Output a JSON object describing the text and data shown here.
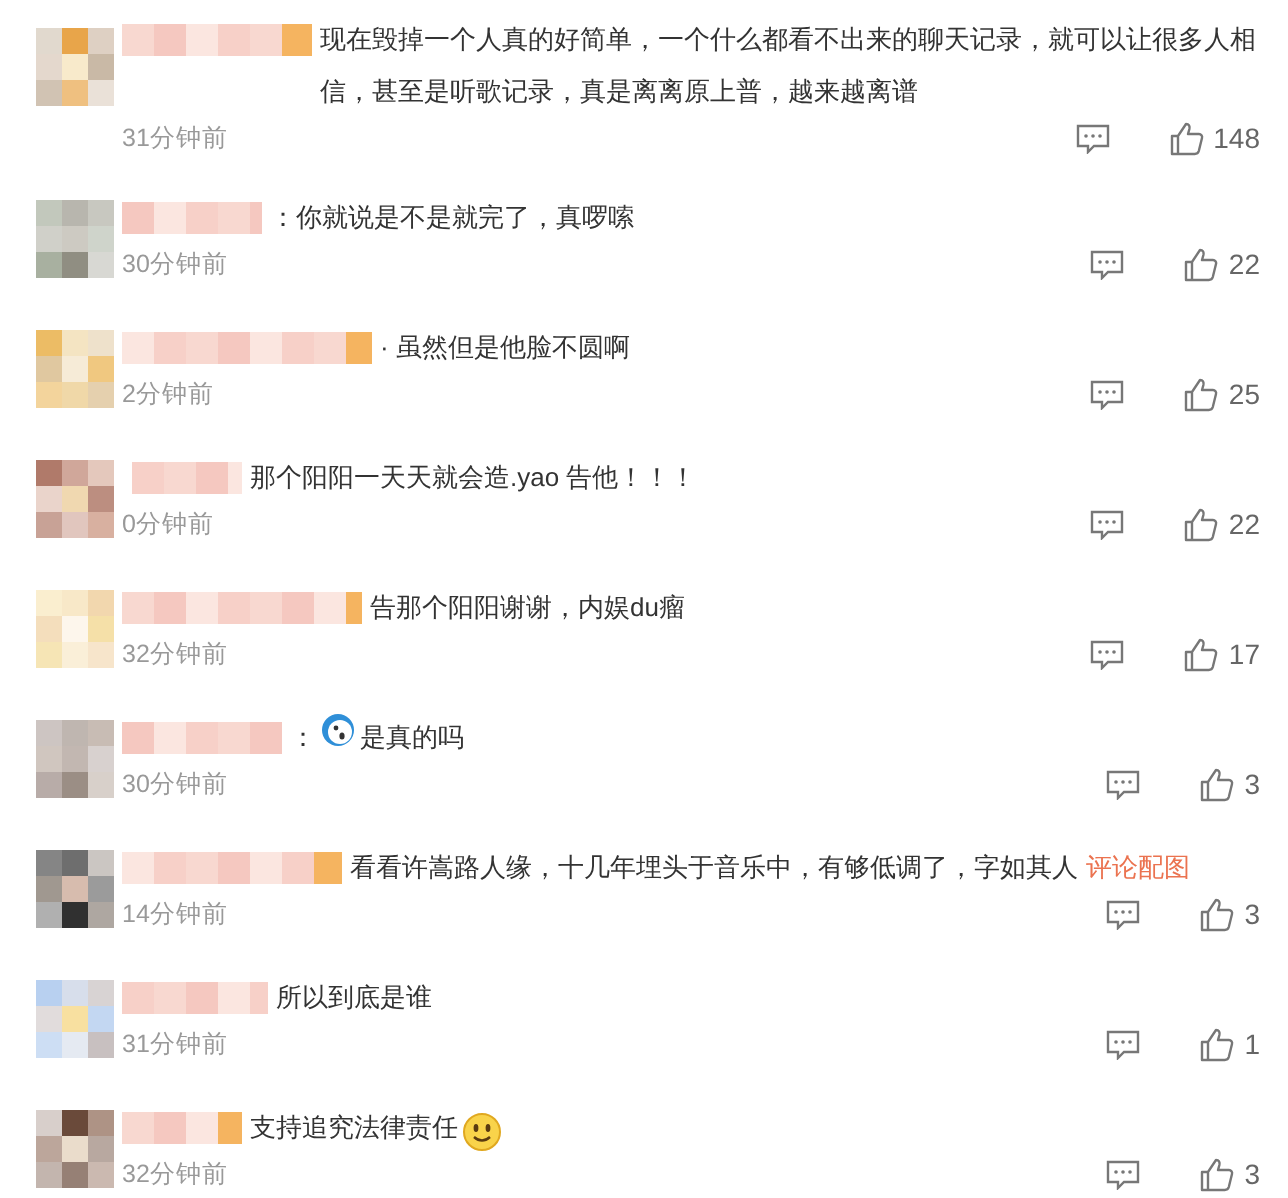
{
  "comments": [
    {
      "text": "现在毁掉一个人真的好简单，一个什么都看不出来的聊天记录，就可以让很多人相信，甚至是听歌记录，真是离离原上普，越来越离谱",
      "time": "31分钟前",
      "likes": "148"
    },
    {
      "text": "：你就说是不是就完了，真啰嗦",
      "time": "30分钟前",
      "likes": "22"
    },
    {
      "text": "· 虽然但是他脸不圆啊",
      "time": "2分钟前",
      "likes": "25"
    },
    {
      "text": "那个阳阳一天天就会造.yao 告他！！！",
      "time": "0分钟前",
      "likes": "22"
    },
    {
      "text": "告那个阳阳谢谢，内娱du瘤",
      "time": "32分钟前",
      "likes": "17"
    },
    {
      "kind": "emoji_lead",
      "text": "：",
      "text_after": "是真的吗",
      "time": "30分钟前",
      "likes": "3"
    },
    {
      "text": "看看许嵩路人缘，十几年埋头于音乐中，有够低调了，字如其人",
      "link": "评论配图",
      "time": "14分钟前",
      "likes": "3"
    },
    {
      "text": "所以到底是谁",
      "time": "31分钟前",
      "likes": "1"
    },
    {
      "kind": "emoji_tail",
      "text": "支持追究法律责任",
      "time": "32分钟前",
      "likes": "3"
    }
  ]
}
